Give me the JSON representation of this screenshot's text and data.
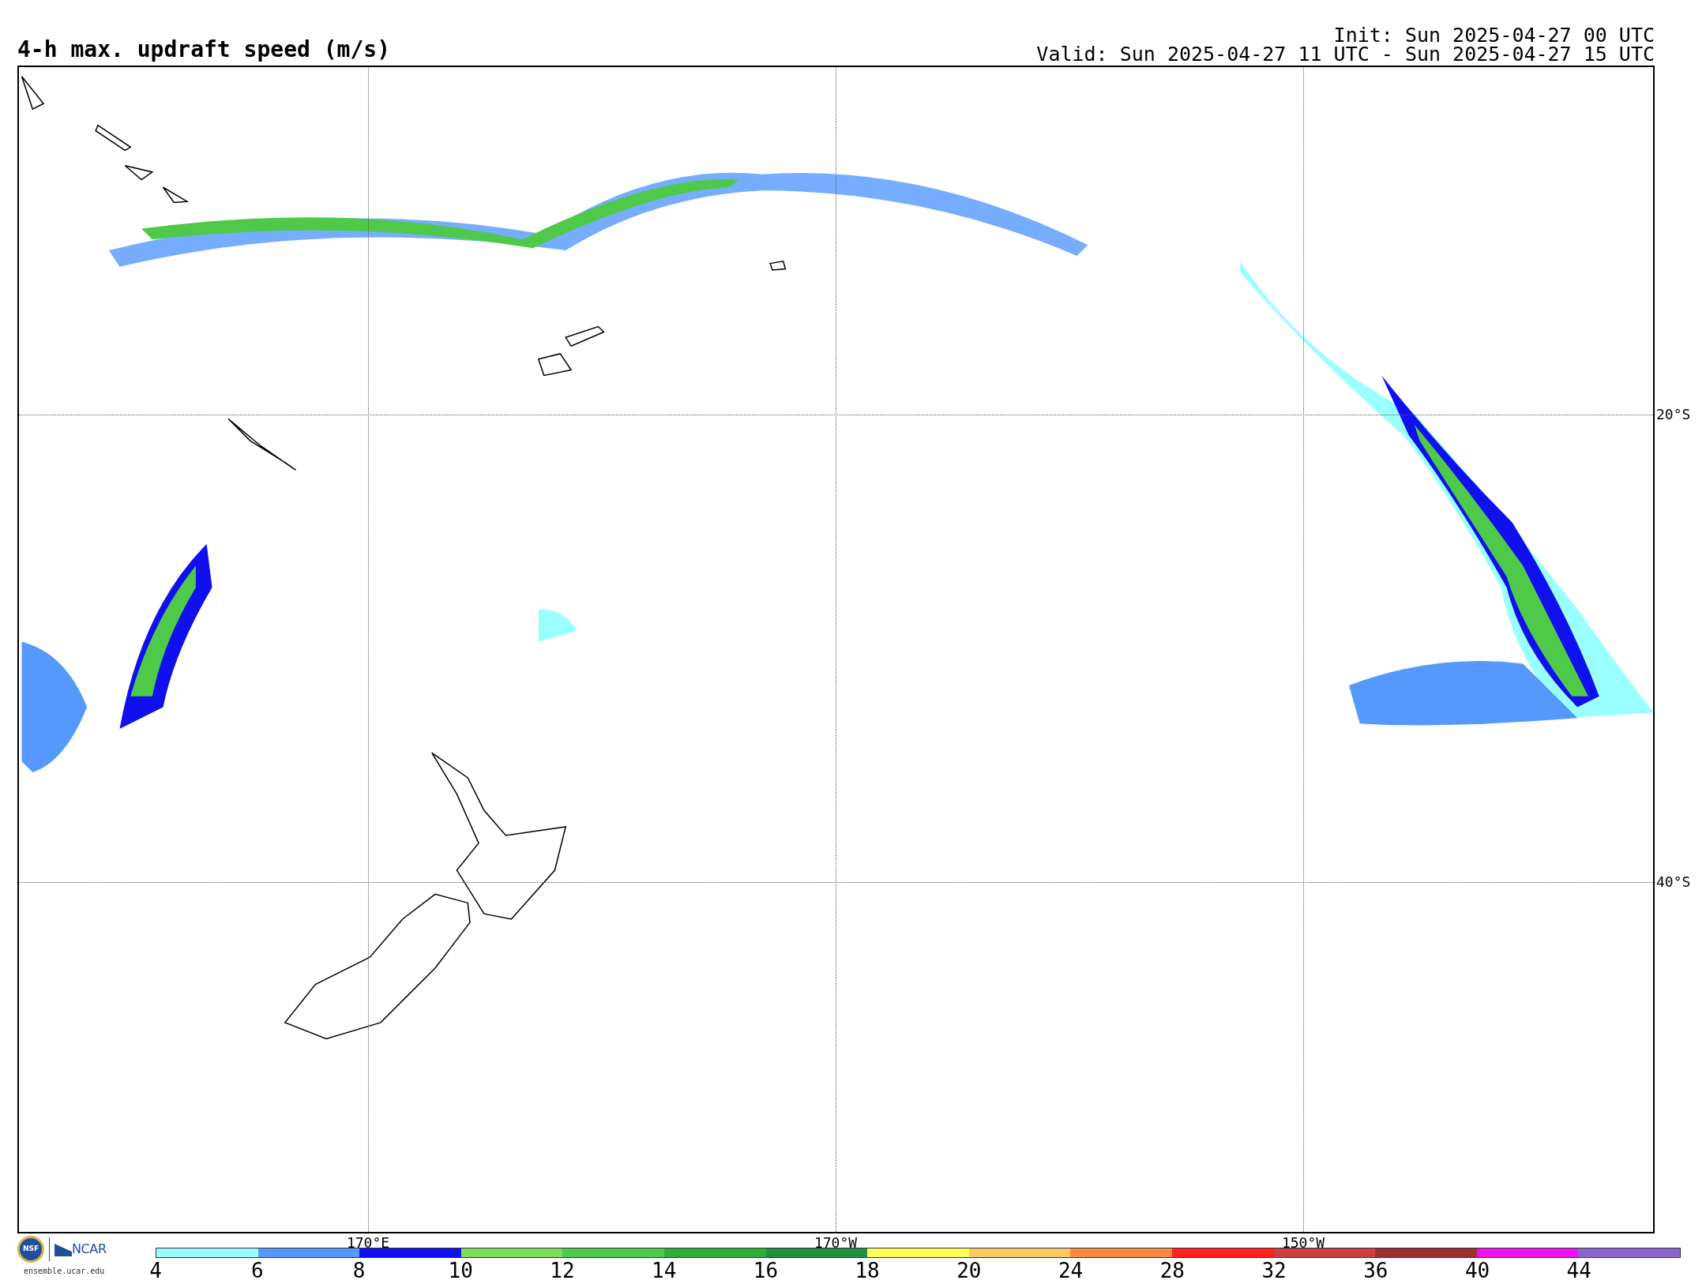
{
  "title": "4-h max. updraft speed (m/s)",
  "init": "Init: Sun 2025-04-27 00 UTC",
  "valid": "Valid: Sun 2025-04-27 11 UTC - Sun 2025-04-27 15 UTC",
  "map": {
    "lat_labels": [
      "20°S",
      "40°S"
    ],
    "lon_labels": [
      "170°E",
      "170°W",
      "150°W"
    ]
  },
  "colorbar": {
    "bins": [
      {
        "color": "#99ffff"
      },
      {
        "color": "#5599ff"
      },
      {
        "color": "#1010ee"
      },
      {
        "color": "#7ddd5a"
      },
      {
        "color": "#4fc94a"
      },
      {
        "color": "#2fae38"
      },
      {
        "color": "#1f9140"
      },
      {
        "color": "#ffff55"
      },
      {
        "color": "#ffc966"
      },
      {
        "color": "#ff8844"
      },
      {
        "color": "#ff2020"
      },
      {
        "color": "#cc4040"
      },
      {
        "color": "#a03030"
      },
      {
        "color": "#ee10ee"
      },
      {
        "color": "#8866cc"
      }
    ],
    "ticks": [
      "4",
      "6",
      "8",
      "10",
      "12",
      "14",
      "16",
      "18",
      "20",
      "24",
      "28",
      "32",
      "36",
      "40",
      "44"
    ]
  },
  "logo": {
    "nsf": "NSF",
    "ncar": "NCAR",
    "url": "ensemble.ucar.edu"
  }
}
